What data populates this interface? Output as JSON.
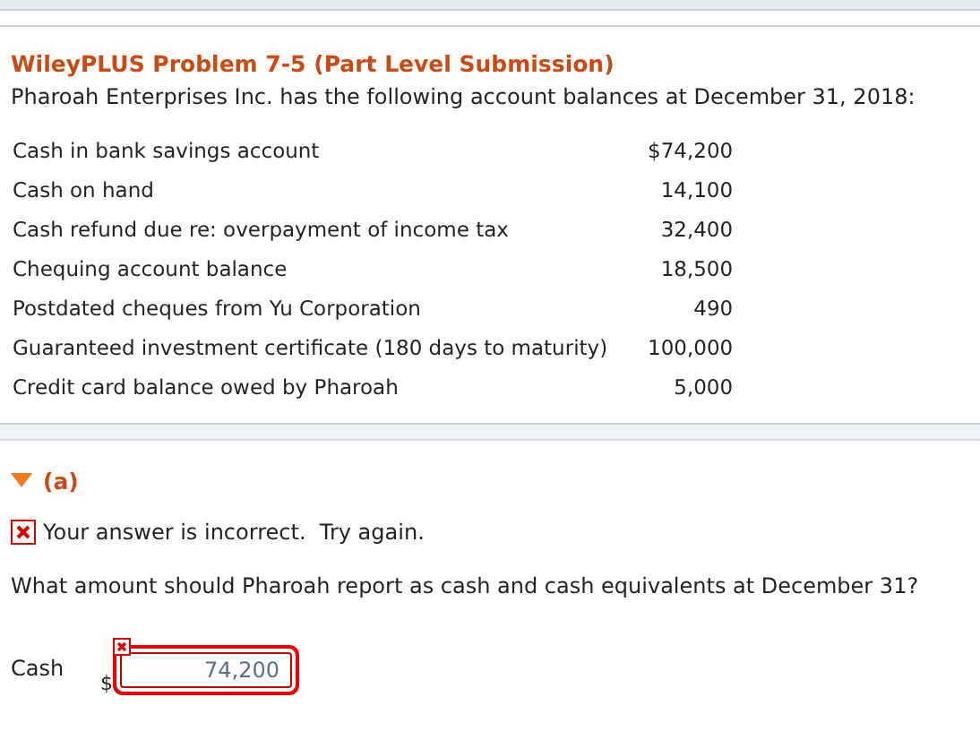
{
  "problem": {
    "title": "WileyPLUS Problem 7-5 (Part Level Submission)",
    "intro": "Pharoah Enterprises Inc. has the following account balances at December 31, 2018:"
  },
  "accounts": [
    {
      "label": "Cash in bank savings account",
      "amount": "$74,200"
    },
    {
      "label": "Cash on hand",
      "amount": "14,100"
    },
    {
      "label": "Cash refund due re: overpayment of income tax",
      "amount": "32,400"
    },
    {
      "label": "Chequing account balance",
      "amount": "18,500"
    },
    {
      "label": "Postdated cheques from Yu Corporation",
      "amount": "490"
    },
    {
      "label": "Guaranteed investment certificate (180 days to maturity)",
      "amount": "100,000"
    },
    {
      "label": "Credit card balance owed by Pharoah",
      "amount": "5,000"
    }
  ],
  "part": {
    "label": "(a)",
    "expanded": true
  },
  "feedback": {
    "correct": false,
    "text": "Your answer is incorrect.  Try again."
  },
  "question": "What amount should Pharoah report as cash and cash equivalents at December 31?",
  "answer": {
    "label": "Cash",
    "currency": "$",
    "value": "74,200",
    "correct": false
  }
}
